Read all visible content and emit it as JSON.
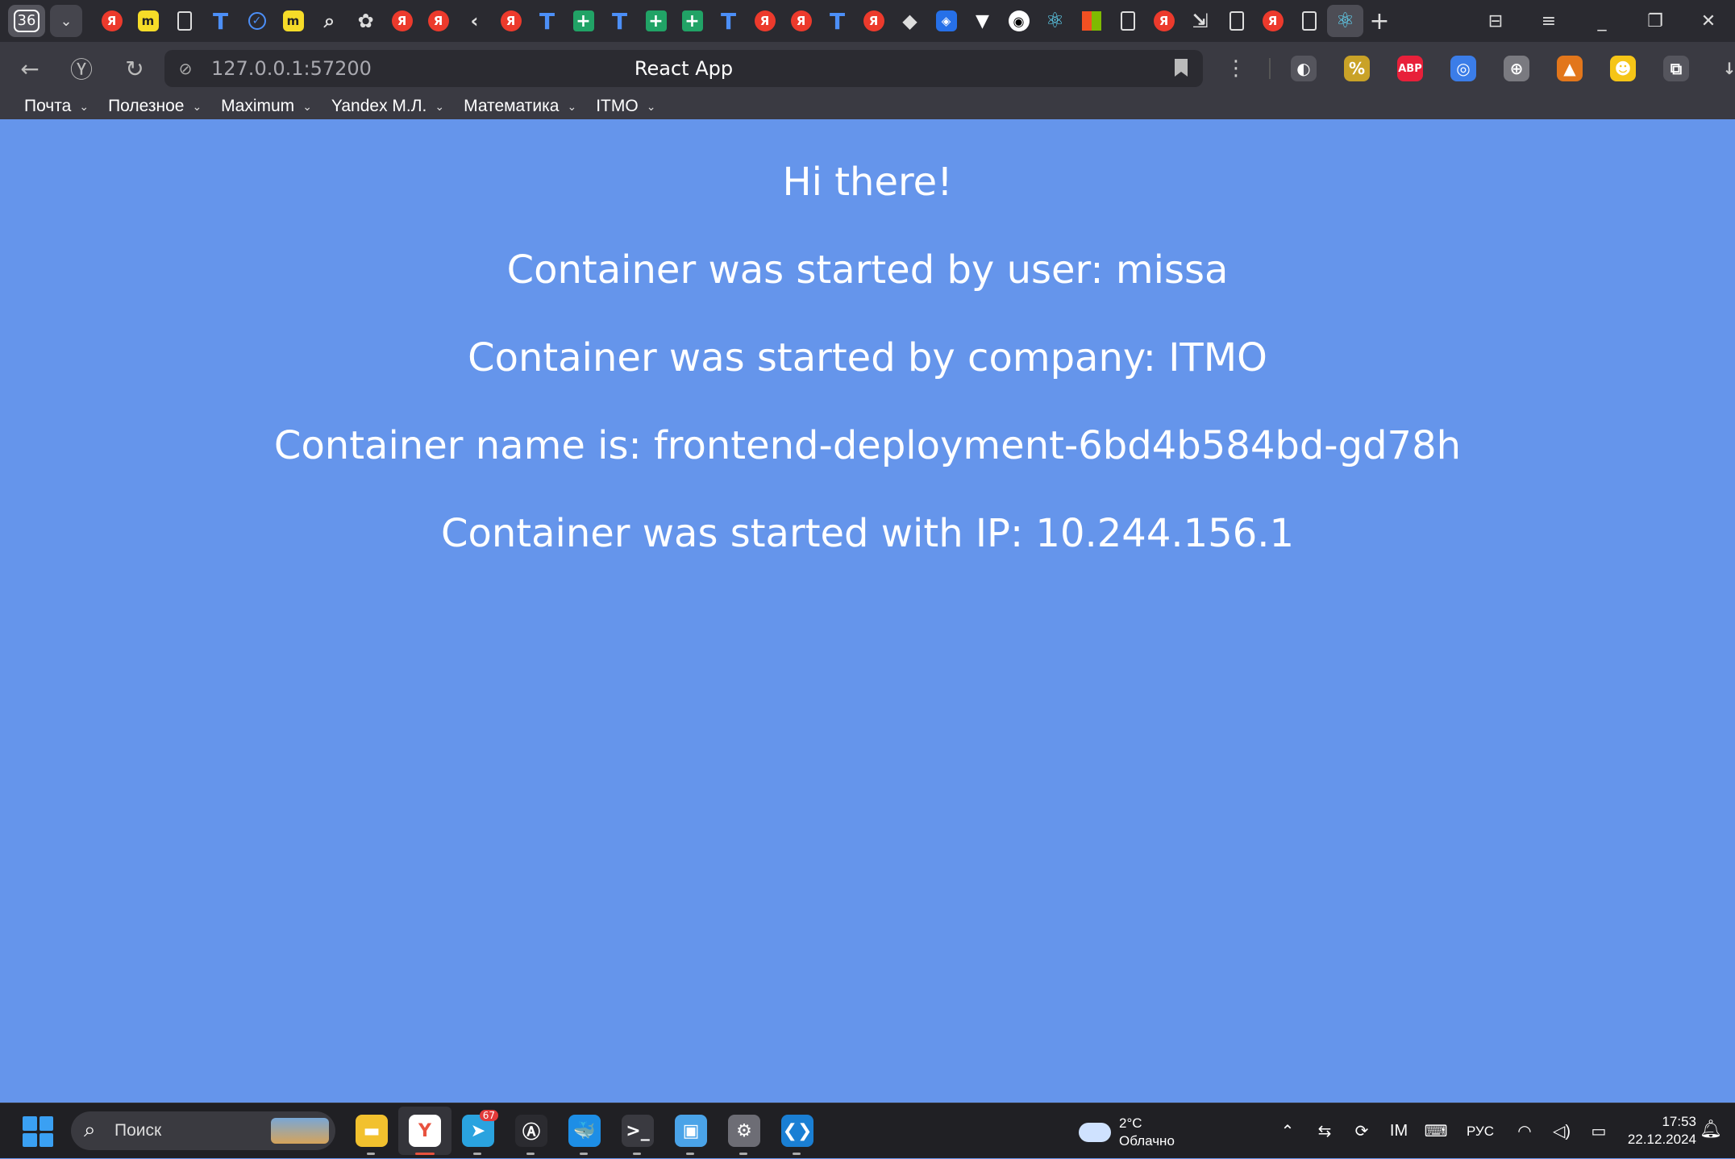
{
  "browser": {
    "tab_counter": "36",
    "tabs": [
      {
        "icon": "yandex-icon",
        "glyph": "Я"
      },
      {
        "icon": "miro-icon",
        "glyph": "m"
      },
      {
        "icon": "document-icon",
        "glyph": ""
      },
      {
        "icon": "tracker-icon",
        "glyph": "T"
      },
      {
        "icon": "tasks-icon",
        "glyph": "✓"
      },
      {
        "icon": "miro-icon",
        "glyph": "m"
      },
      {
        "icon": "lens-icon",
        "glyph": "⌕"
      },
      {
        "icon": "openai-icon",
        "glyph": "✿"
      },
      {
        "icon": "yandex-icon",
        "glyph": "Я"
      },
      {
        "icon": "yandex-icon",
        "glyph": "Я"
      },
      {
        "icon": "back-tab-icon",
        "glyph": "‹"
      },
      {
        "icon": "yandex-icon",
        "glyph": "Я"
      },
      {
        "icon": "tracker-icon",
        "glyph": "T"
      },
      {
        "icon": "sheets-icon",
        "glyph": "+"
      },
      {
        "icon": "tracker-icon",
        "glyph": "T"
      },
      {
        "icon": "sheets-icon",
        "glyph": "+"
      },
      {
        "icon": "sheets-icon",
        "glyph": "+"
      },
      {
        "icon": "tracker-icon",
        "glyph": "T"
      },
      {
        "icon": "yandex-icon",
        "glyph": "Я"
      },
      {
        "icon": "yandex-icon",
        "glyph": "Я"
      },
      {
        "icon": "tracker-icon",
        "glyph": "T"
      },
      {
        "icon": "yandex-icon",
        "glyph": "Я"
      },
      {
        "icon": "cube-icon",
        "glyph": "◆"
      },
      {
        "icon": "shield-icon",
        "glyph": "◈"
      },
      {
        "icon": "vercel-icon",
        "glyph": "▼"
      },
      {
        "icon": "github-icon",
        "glyph": "◉"
      },
      {
        "icon": "react-icon",
        "glyph": "⚛"
      },
      {
        "icon": "microsoft-icon",
        "glyph": ""
      },
      {
        "icon": "document-icon",
        "glyph": ""
      },
      {
        "icon": "yandex-icon",
        "glyph": "Я"
      },
      {
        "icon": "cursor-icon",
        "glyph": "⇲"
      },
      {
        "icon": "document-icon",
        "glyph": ""
      },
      {
        "icon": "yandex-icon",
        "glyph": "Я"
      },
      {
        "icon": "document-icon",
        "glyph": ""
      },
      {
        "icon": "react-icon",
        "glyph": "⚛",
        "active": true
      }
    ],
    "url": "127.0.0.1:57200",
    "page_title": "React App",
    "extensions": [
      {
        "icon": "sync-icon",
        "glyph": "◐",
        "color": "#55555d"
      },
      {
        "icon": "coupon-icon",
        "glyph": "%",
        "color": "#c9a227"
      },
      {
        "icon": "adblock-icon",
        "glyph": "ABP",
        "color": "#e8203a"
      },
      {
        "icon": "color-picker-icon",
        "glyph": "◎",
        "color": "#3b7de8"
      },
      {
        "icon": "globe-icon",
        "glyph": "⊕",
        "color": "#7a7a80"
      },
      {
        "icon": "metamask-icon",
        "glyph": "▲",
        "color": "#e2761b"
      },
      {
        "icon": "tampermonkey-icon",
        "glyph": "☻",
        "color": "#f5c517"
      },
      {
        "icon": "translate-icon",
        "glyph": "⧉",
        "color": "#55555d"
      },
      {
        "icon": "download-icon",
        "glyph": "↓",
        "color": "transparent"
      }
    ],
    "bookmarks": [
      "Почта",
      "Полезное",
      "Maximum",
      "Yandex М.Л.",
      "Математика",
      "ITMO"
    ]
  },
  "page": {
    "greeting": "Hi there!",
    "user_line": "Container was started by user: missa",
    "company_line": "Container was started by company: ITMO",
    "name_line": "Container name is: frontend-deployment-6bd4b584bd-gd78h",
    "ip_line": "Container was started with IP: 10.244.156.1",
    "background_color": "#6595eb"
  },
  "taskbar": {
    "search_placeholder": "Поиск",
    "apps": [
      {
        "icon": "file-explorer-icon",
        "glyph": "▬",
        "color": "#f2c12e"
      },
      {
        "icon": "yandex-browser-icon",
        "glyph": "Y",
        "color": "#ffffff",
        "active": true
      },
      {
        "icon": "telegram-icon",
        "glyph": "➤",
        "color": "#2aa3df",
        "badge": "67"
      },
      {
        "icon": "anarchy-icon",
        "glyph": "Ⓐ",
        "color": "#2b2b30"
      },
      {
        "icon": "docker-icon",
        "glyph": "🐳",
        "color": "#1d8ee6"
      },
      {
        "icon": "terminal-icon",
        "glyph": ">_",
        "color": "#3a3a40"
      },
      {
        "icon": "remote-desktop-icon",
        "glyph": "▣",
        "color": "#4aa3e8"
      },
      {
        "icon": "settings-icon",
        "glyph": "⚙",
        "color": "#6d6d75"
      },
      {
        "icon": "vscode-icon",
        "glyph": "❮❯",
        "color": "#1a7fd4"
      }
    ],
    "weather_temp": "2°C",
    "weather_desc": "Облачно",
    "tray": [
      {
        "icon": "chevron-up-icon",
        "glyph": "⌃"
      },
      {
        "icon": "mixer-icon",
        "glyph": "⇆"
      },
      {
        "icon": "sync-tray-icon",
        "glyph": "⟳"
      },
      {
        "icon": "metrics-icon",
        "glyph": "IM"
      },
      {
        "icon": "keyboard-icon",
        "glyph": "⌨"
      },
      {
        "icon": "language-indicator",
        "glyph": "РУС"
      },
      {
        "icon": "wifi-icon",
        "glyph": "◠"
      },
      {
        "icon": "volume-icon",
        "glyph": "◁)"
      },
      {
        "icon": "battery-icon",
        "glyph": "▭"
      }
    ],
    "time": "17:53",
    "date": "22.12.2024"
  }
}
